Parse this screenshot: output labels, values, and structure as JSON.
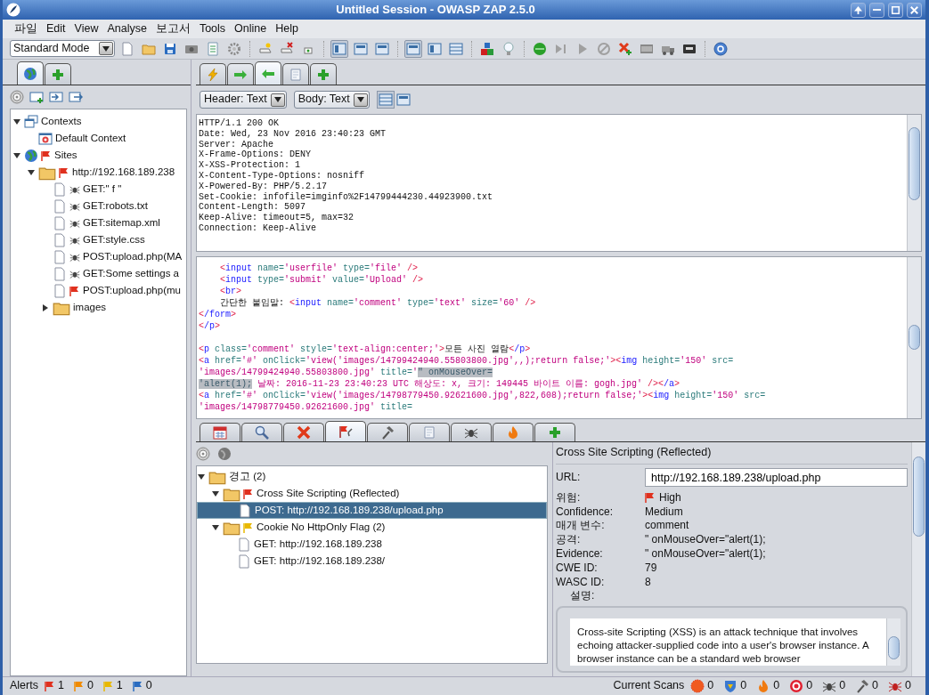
{
  "window": {
    "title": "Untitled Session - OWASP ZAP 2.5.0"
  },
  "menu": [
    "파일",
    "Edit",
    "View",
    "Analyse",
    "보고서",
    "Tools",
    "Online",
    "Help"
  ],
  "toolbar": {
    "mode": "Standard Mode",
    "layout_buttons": [
      {
        "selected": true
      },
      {
        "selected": false
      },
      {
        "selected": false
      }
    ],
    "panel_buttons": [
      {
        "selected": true
      },
      {
        "selected": false
      },
      {
        "selected": false
      }
    ]
  },
  "left_tabs": [
    {
      "selected": true
    },
    {
      "selected": false
    }
  ],
  "sites_tree": [
    {
      "label": "Contexts",
      "kind": "contexts",
      "expanded": true,
      "children": [
        {
          "label": "Default Context",
          "kind": "context"
        }
      ]
    },
    {
      "label": "Sites",
      "kind": "globe",
      "color": "#e0301e",
      "expanded": true,
      "children": [
        {
          "label": "http://192.168.189.238",
          "kind": "folder",
          "color": "#e0301e",
          "expanded": true,
          "children": [
            {
              "label": "GET:\" f \"",
              "kind": "page",
              "spider": true
            },
            {
              "label": "GET:robots.txt",
              "kind": "page",
              "spider": true
            },
            {
              "label": "GET:sitemap.xml",
              "kind": "page",
              "spider": true
            },
            {
              "label": "GET:style.css",
              "kind": "page",
              "spider": true
            },
            {
              "label": "POST:upload.php(MA",
              "kind": "page",
              "spider": true
            },
            {
              "label": "GET:Some settings a",
              "kind": "page",
              "spider": true
            },
            {
              "label": "POST:upload.php(mu",
              "kind": "page",
              "spider": false,
              "color": "#e0301e"
            },
            {
              "label": "images",
              "kind": "folder",
              "expanded": false
            }
          ]
        }
      ]
    }
  ],
  "right_tabs": [
    {
      "selected": false
    },
    {
      "selected": false
    },
    {
      "selected": true
    },
    {
      "selected": false
    },
    {
      "selected": false
    }
  ],
  "view_bar": {
    "header_select": "Header: Text",
    "body_select": "Body: Text",
    "view_buttons": [
      {
        "selected": true
      },
      {
        "selected": false
      }
    ]
  },
  "response_header": [
    "HTTP/1.1 200 OK",
    "Date: Wed, 23 Nov 2016 23:40:23 GMT",
    "Server: Apache",
    "X-Frame-Options: DENY",
    "X-XSS-Protection: 1",
    "X-Content-Type-Options: nosniff",
    "X-Powered-By: PHP/5.2.17",
    "Set-Cookie: infofile=imginfo%2F14799444230.44923900.txt",
    "Content-Length: 5097",
    "Keep-Alive: timeout=5, max=32",
    "Connection: Keep-Alive"
  ],
  "response_body": [
    {
      "indented": true,
      "segments": [
        {
          "text": "<",
          "kind": "p"
        },
        {
          "text": "input",
          "kind": "t"
        },
        {
          "text": " name=",
          "kind": "a"
        },
        {
          "text": "'userfile'",
          "kind": "v"
        },
        {
          "text": " type=",
          "kind": "a"
        },
        {
          "text": "'file'",
          "kind": "v"
        },
        {
          "text": " />",
          "kind": "p"
        }
      ]
    },
    {
      "indented": true,
      "segments": [
        {
          "text": "<",
          "kind": "p"
        },
        {
          "text": "input",
          "kind": "t"
        },
        {
          "text": " type=",
          "kind": "a"
        },
        {
          "text": "'submit'",
          "kind": "v"
        },
        {
          "text": " value=",
          "kind": "a"
        },
        {
          "text": "'Upload'",
          "kind": "v"
        },
        {
          "text": " />",
          "kind": "p"
        }
      ]
    },
    {
      "indented": true,
      "segments": [
        {
          "text": "<",
          "kind": "p"
        },
        {
          "text": "br",
          "kind": "t"
        },
        {
          "text": ">",
          "kind": "p"
        }
      ]
    },
    {
      "indented": true,
      "segments": [
        {
          "text": "간단한 붙임말: ",
          "kind": "x"
        },
        {
          "text": "<",
          "kind": "p"
        },
        {
          "text": "input",
          "kind": "t"
        },
        {
          "text": " name=",
          "kind": "a"
        },
        {
          "text": "'comment'",
          "kind": "v"
        },
        {
          "text": " type=",
          "kind": "a"
        },
        {
          "text": "'text'",
          "kind": "v"
        },
        {
          "text": " size=",
          "kind": "a"
        },
        {
          "text": "'60'",
          "kind": "v"
        },
        {
          "text": " />",
          "kind": "p"
        }
      ]
    },
    {
      "indented": false,
      "segments": [
        {
          "text": "<",
          "kind": "p"
        },
        {
          "text": "/form",
          "kind": "t"
        },
        {
          "text": ">",
          "kind": "p"
        }
      ]
    },
    {
      "indented": false,
      "segments": [
        {
          "text": "<",
          "kind": "p"
        },
        {
          "text": "/p",
          "kind": "t"
        },
        {
          "text": ">",
          "kind": "p"
        }
      ]
    },
    {
      "indented": false,
      "blank_before": true,
      "segments": [
        {
          "text": "<",
          "kind": "p"
        },
        {
          "text": "p",
          "kind": "t"
        },
        {
          "text": " class=",
          "kind": "a"
        },
        {
          "text": "'comment'",
          "kind": "v"
        },
        {
          "text": " style=",
          "kind": "a"
        },
        {
          "text": "'text-align:center;'",
          "kind": "v"
        },
        {
          "text": ">",
          "kind": "p"
        },
        {
          "text": "모든 사진 열람",
          "kind": "x"
        },
        {
          "text": "<",
          "kind": "p"
        },
        {
          "text": "/p",
          "kind": "t"
        },
        {
          "text": ">",
          "kind": "p"
        }
      ]
    },
    {
      "indented": false,
      "segments": [
        {
          "text": "<",
          "kind": "p"
        },
        {
          "text": "a",
          "kind": "t"
        },
        {
          "text": " href=",
          "kind": "a"
        },
        {
          "text": "'#'",
          "kind": "v"
        },
        {
          "text": " onClick=",
          "kind": "a"
        },
        {
          "text": "'view('images/14799424940.55803800.jpg',,);return false;'",
          "kind": "v"
        },
        {
          "text": "><",
          "kind": "p"
        },
        {
          "text": "img",
          "kind": "t"
        },
        {
          "text": " height=",
          "kind": "a"
        },
        {
          "text": "'150'",
          "kind": "v"
        },
        {
          "text": " src=",
          "kind": "a"
        }
      ]
    },
    {
      "indented": false,
      "segments": [
        {
          "text": "'images/14799424940.55803800.jpg'",
          "kind": "v"
        },
        {
          "text": " title=",
          "kind": "a"
        },
        {
          "text": "'",
          "kind": "v"
        },
        {
          "text": "\" onMouseOver=",
          "kind": "h"
        }
      ]
    },
    {
      "indented": false,
      "segments": [
        {
          "text": "'alert(1);",
          "kind": "h"
        },
        {
          "text": " 날짜: 2016-11-23 23:40:23 UTC 해상도: x, 크기: 149445 바이트 이름: gogh.jpg'",
          "kind": "v"
        },
        {
          "text": " /><",
          "kind": "p"
        },
        {
          "text": "/a",
          "kind": "t"
        },
        {
          "text": ">",
          "kind": "p"
        }
      ]
    },
    {
      "indented": false,
      "segments": [
        {
          "text": "<",
          "kind": "p"
        },
        {
          "text": "a",
          "kind": "t"
        },
        {
          "text": " href=",
          "kind": "a"
        },
        {
          "text": "'#'",
          "kind": "v"
        },
        {
          "text": " onClick=",
          "kind": "a"
        },
        {
          "text": "'view('images/14798779450.92621600.jpg',822,608);return false;'",
          "kind": "v"
        },
        {
          "text": "><",
          "kind": "p"
        },
        {
          "text": "img",
          "kind": "t"
        },
        {
          "text": " height=",
          "kind": "a"
        },
        {
          "text": "'150'",
          "kind": "v"
        },
        {
          "text": " src=",
          "kind": "a"
        }
      ]
    },
    {
      "indented": false,
      "segments": [
        {
          "text": "'images/14798779450.92621600.jpg'",
          "kind": "v"
        },
        {
          "text": " title=",
          "kind": "a"
        }
      ]
    }
  ],
  "bottom_tabs": [
    {
      "selected": false
    },
    {
      "selected": false
    },
    {
      "selected": false
    },
    {
      "selected": true
    },
    {
      "selected": false
    },
    {
      "selected": false
    },
    {
      "selected": false
    },
    {
      "selected": false
    },
    {
      "selected": false
    }
  ],
  "alerts_tree": [
    {
      "label": "경고 (2)",
      "kind": "folder",
      "expanded": true,
      "selected": false,
      "children": [
        {
          "label": "Cross Site Scripting (Reflected)",
          "kind": "folder",
          "color": "#e0301e",
          "expanded": true,
          "selected": false,
          "children": [
            {
              "label": "POST: http://192.168.189.238/upload.php",
              "kind": "page",
              "selected": true
            }
          ]
        },
        {
          "label": "Cookie No HttpOnly Flag (2)",
          "kind": "folder",
          "color": "#e8b800",
          "expanded": true,
          "selected": false,
          "children": [
            {
              "label": "GET: http://192.168.189.238",
              "kind": "page",
              "selected": false
            },
            {
              "label": "GET: http://192.168.189.238/",
              "kind": "page",
              "selected": false
            }
          ]
        }
      ]
    }
  ],
  "alert_details": {
    "title": "Cross Site Scripting (Reflected)",
    "url_label": "URL:",
    "url": "http://192.168.189.238/upload.php",
    "fields": [
      {
        "label": "위험:",
        "value": "High",
        "color": "#e0301e"
      },
      {
        "label": "Confidence:",
        "value": "Medium"
      },
      {
        "label": "매개 변수:",
        "value": "comment"
      },
      {
        "label": "공격:",
        "value": "\" onMouseOver=\"alert(1);"
      },
      {
        "label": "Evidence:",
        "value": "\" onMouseOver=\"alert(1);"
      },
      {
        "label": "CWE ID:",
        "value": "79"
      },
      {
        "label": "WASC ID:",
        "value": "8"
      }
    ],
    "description_label": "설명:",
    "description": "Cross-site Scripting (XSS) is an attack technique that involves echoing attacker-supplied code into a user's browser instance. A browser instance can be a standard web browser"
  },
  "status_bar": {
    "alerts_label": "Alerts",
    "alert_counts": [
      {
        "color": "#e0301e",
        "count": "1"
      },
      {
        "color": "#f08a00",
        "count": "0"
      },
      {
        "color": "#e8b800",
        "count": "1"
      },
      {
        "color": "#2a6cc0",
        "count": "0"
      }
    ],
    "scans_label": "Current Scans",
    "scan_counts": [
      "0",
      "0",
      "0",
      "0",
      "0",
      "0",
      "0"
    ]
  }
}
